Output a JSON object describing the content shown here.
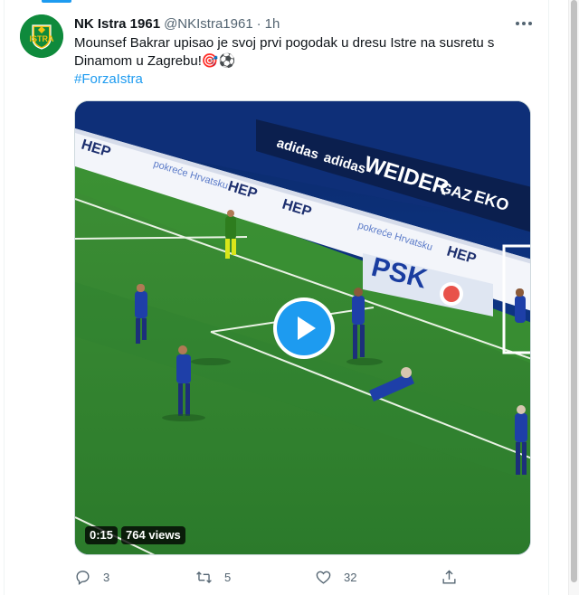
{
  "tweet": {
    "author": {
      "name": "NK Istra 1961",
      "handle": "@NKIstra1961",
      "separator": "·",
      "time": "1h"
    },
    "text": "Mounsef Bakrar upisao je svoj prvi pogodak u dresu Istre na susretu s Dinamom u Zagrebu!",
    "emojis": "🎯⚽",
    "hashtag": "#ForzaIstra",
    "video": {
      "duration": "0:15",
      "views": "764 views"
    },
    "stats": {
      "replies": "3",
      "retweets": "5",
      "likes": "32"
    }
  },
  "ads": {
    "hep": "HEP",
    "adidas": "adidas",
    "weider": "WEIDER",
    "gaz": "GAZ",
    "eko": "EKO",
    "pokrece": "pokreće Hrvatsku",
    "psk": "PSK"
  },
  "colors": {
    "accent": "#1d9bf0",
    "muted": "#536471",
    "pitch": "#2f7d2f",
    "club_green": "#0f8a3c"
  }
}
